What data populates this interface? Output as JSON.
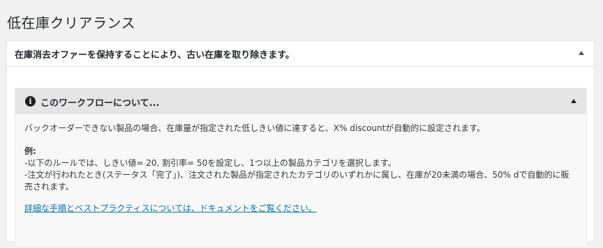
{
  "page": {
    "title": "低在庫クリアランス"
  },
  "postbox": {
    "title": "在庫消去オファーを保持することにより、古い在庫を取り除きます。"
  },
  "workflow": {
    "header_title": "このワークフローについて...",
    "description": "バックオーダーできない製品の場合、在庫量が指定された低しきい値に達すると、X% discountが自動的に設定されます。",
    "example_heading": "例:",
    "example_lines": [
      "-以下のルールでは、しきい値= 20, 割引率= 50を設定し、1つ以上の製品カテゴリを選択します。",
      "-注文が行われたとき(ステータス「完了」)、注文された製品が指定されたカテゴリのいずれかに属し、在庫が20未満の場合、50% dで自動的に販売されます。"
    ],
    "doc_link": "詳細な手順とベストプラクティスについては、ドキュメントをご覧ください。"
  },
  "icons": {
    "info": "info-icon",
    "toggle": "triangle-up-icon"
  }
}
